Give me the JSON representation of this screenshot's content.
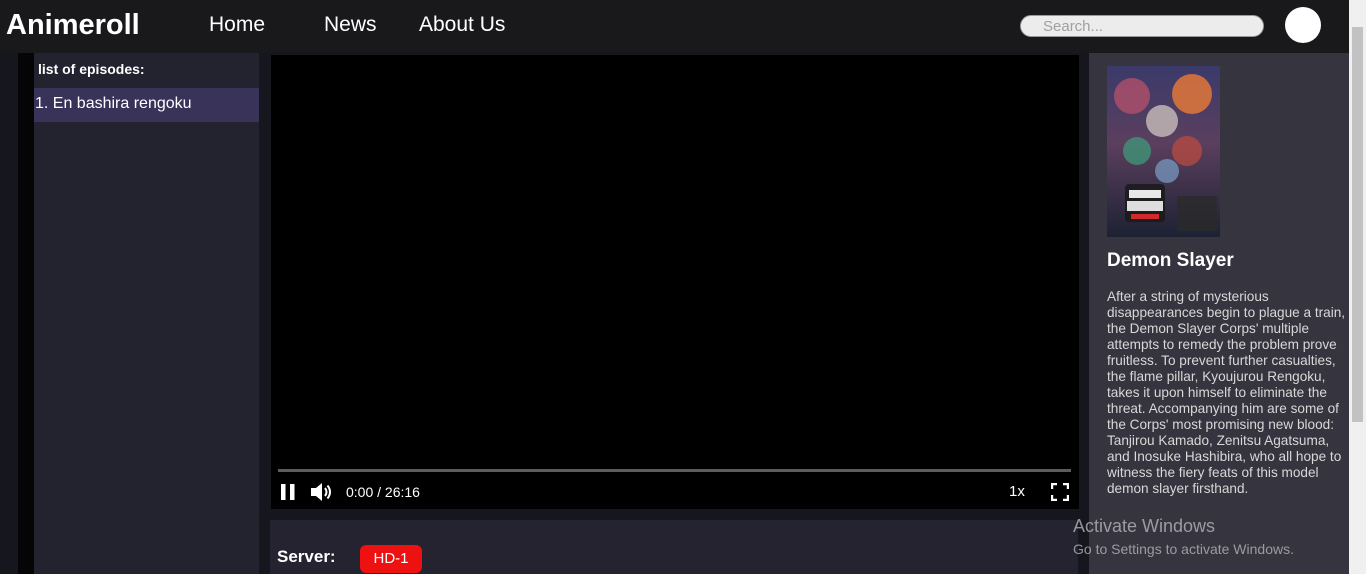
{
  "navbar": {
    "brand": "Animeroll",
    "links": [
      "Home",
      "News",
      "About Us"
    ],
    "search_placeholder": "Search..."
  },
  "episodes": {
    "title": "list of episodes:",
    "items": [
      "1. En bashira rengoku"
    ]
  },
  "player": {
    "time": "0:00 / 26:16",
    "speed": "1x",
    "progress": 0
  },
  "server": {
    "label": "Server:",
    "button": "HD-1"
  },
  "anime": {
    "title": "Demon Slayer",
    "description": "After a string of mysterious disappearances begin to plague a train, the Demon Slayer Corps' multiple attempts to remedy the problem prove fruitless. To prevent further casualties, the flame pillar, Kyoujurou Rengoku, takes it upon himself to eliminate the threat. Accompanying him are some of the Corps' most promising new blood: Tanjirou Kamado, Zenitsu Agatsuma, and Inosuke Hashibira, who all hope to witness the fiery feats of this model demon slayer firsthand."
  },
  "watermark": {
    "title": "Activate Windows",
    "subtitle": "Go to Settings to activate Windows."
  },
  "colors": {
    "navbar": "#19191c",
    "episode_panel": "#23222f",
    "episode_active": "#39335a",
    "info_panel": "#35343f",
    "server_button": "#ee1111"
  },
  "icons": [
    "pause-icon",
    "volume-icon",
    "fullscreen-icon"
  ]
}
